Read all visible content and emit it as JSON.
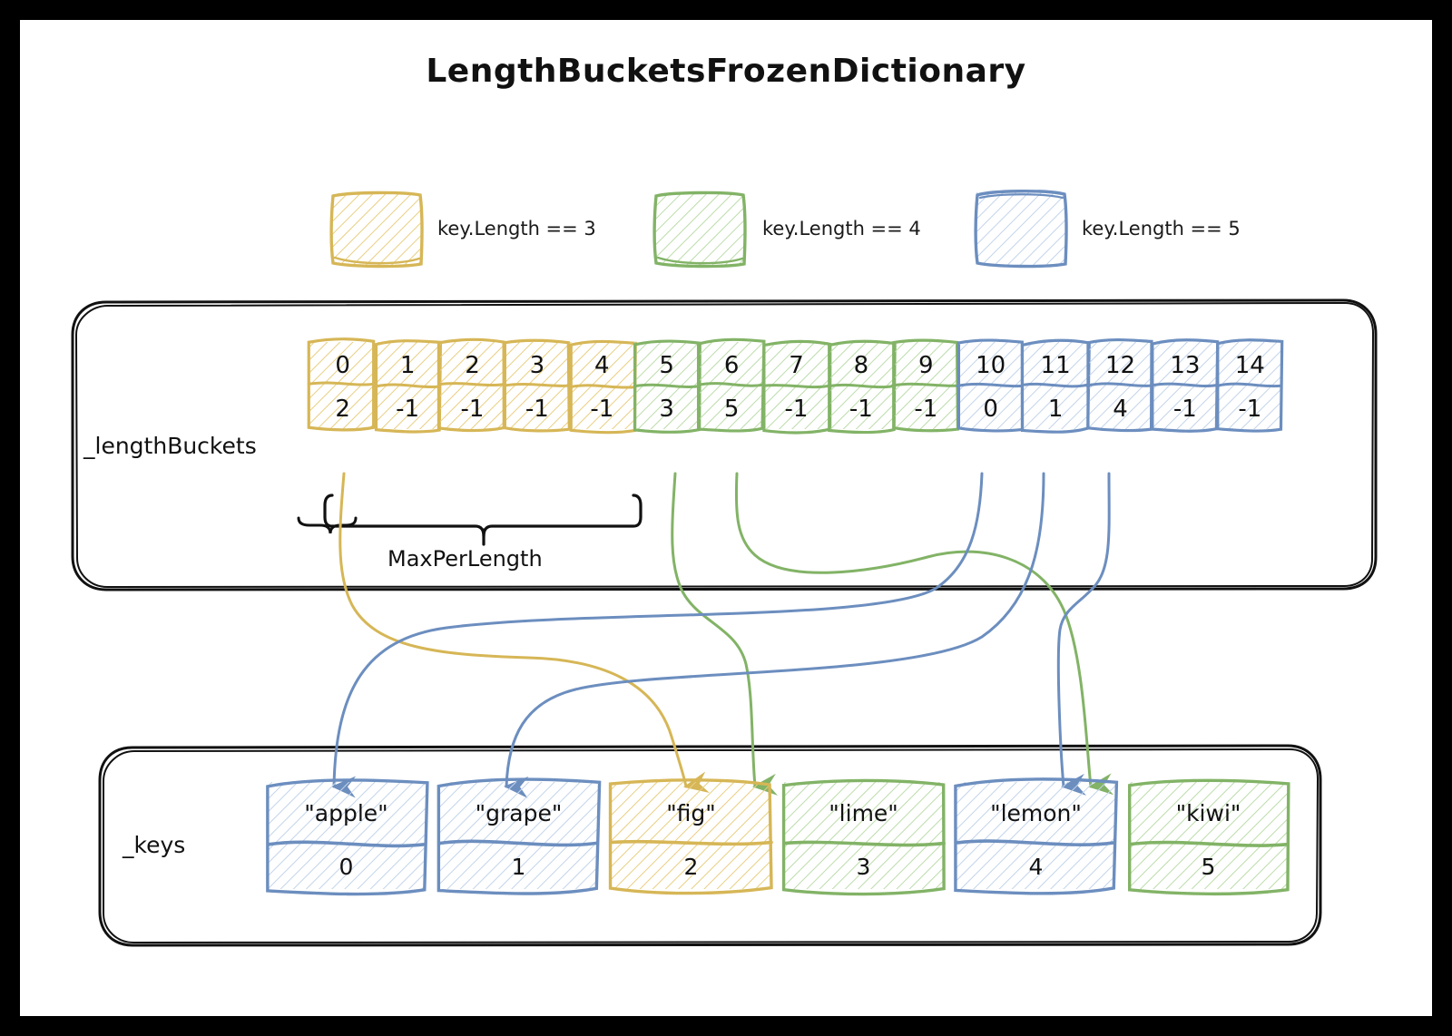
{
  "title": "LengthBucketsFrozenDictionary",
  "colors": {
    "yellow": "#d6b656",
    "yellow_fill": "#fff7e0",
    "green": "#82b366",
    "green_fill": "#f2f9ee",
    "blue": "#6c8ebf",
    "blue_fill": "#eef3fb",
    "ink": "#111111"
  },
  "legend": {
    "items": [
      {
        "label": "key.Length == 3",
        "color_key": "yellow"
      },
      {
        "label": "key.Length == 4",
        "color_key": "green"
      },
      {
        "label": "key.Length == 5",
        "color_key": "blue"
      }
    ]
  },
  "length_buckets": {
    "label": "_lengthBuckets",
    "brace_label": "MaxPerLength",
    "indices": [
      "0",
      "1",
      "2",
      "3",
      "4",
      "5",
      "6",
      "7",
      "8",
      "9",
      "10",
      "11",
      "12",
      "13",
      "14"
    ],
    "values": [
      "2",
      "-1",
      "-1",
      "-1",
      "-1",
      "3",
      "5",
      "-1",
      "-1",
      "-1",
      "0",
      "1",
      "4",
      "-1",
      "-1"
    ],
    "group_colors": [
      "yellow",
      "yellow",
      "yellow",
      "yellow",
      "yellow",
      "green",
      "green",
      "green",
      "green",
      "green",
      "blue",
      "blue",
      "blue",
      "blue",
      "blue"
    ]
  },
  "keys": {
    "label": "_keys",
    "items": [
      {
        "name": "\"apple\"",
        "index": "0",
        "color_key": "blue"
      },
      {
        "name": "\"grape\"",
        "index": "1",
        "color_key": "blue"
      },
      {
        "name": "\"fig\"",
        "index": "2",
        "color_key": "yellow"
      },
      {
        "name": "\"lime\"",
        "index": "3",
        "color_key": "green"
      },
      {
        "name": "\"lemon\"",
        "index": "4",
        "color_key": "blue"
      },
      {
        "name": "\"kiwi\"",
        "index": "5",
        "color_key": "green"
      }
    ]
  },
  "arrows": [
    {
      "from_bucket_index": 0,
      "to_key_index": 2,
      "color_key": "yellow"
    },
    {
      "from_bucket_index": 5,
      "to_key_index": 3,
      "color_key": "green"
    },
    {
      "from_bucket_index": 6,
      "to_key_index": 5,
      "color_key": "green"
    },
    {
      "from_bucket_index": 10,
      "to_key_index": 0,
      "color_key": "blue"
    },
    {
      "from_bucket_index": 11,
      "to_key_index": 1,
      "color_key": "blue"
    },
    {
      "from_bucket_index": 12,
      "to_key_index": 4,
      "color_key": "blue"
    }
  ]
}
